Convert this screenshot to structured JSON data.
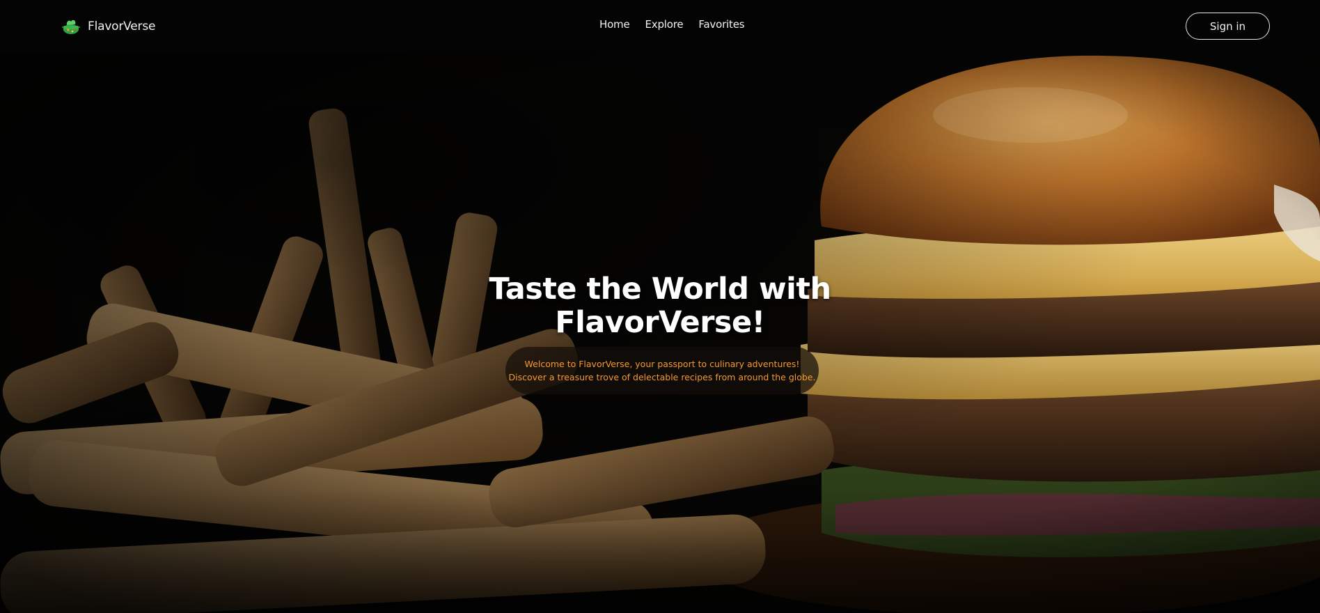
{
  "brand": {
    "name": "FlavorVerse",
    "logo_icon": "chef-pot-icon",
    "logo_color": "#3bb54a"
  },
  "nav": {
    "links": [
      {
        "label": "Home"
      },
      {
        "label": "Explore"
      },
      {
        "label": "Favorites"
      }
    ],
    "signin_label": "Sign in"
  },
  "hero": {
    "title_line1": "Taste the World with",
    "title_line2": "FlavorVerse!",
    "tagline_line1": "Welcome to FlavorVerse, your passport to culinary adventures!",
    "tagline_line2": "Discover a treasure trove of delectable recipes from around the globe.",
    "tagline_color": "#f59a2e",
    "background_image": "burger-and-fries-photo"
  },
  "colors": {
    "navbar_bg": "#040404",
    "text_primary": "#ffffff",
    "accent_orange": "#f59a2e"
  }
}
